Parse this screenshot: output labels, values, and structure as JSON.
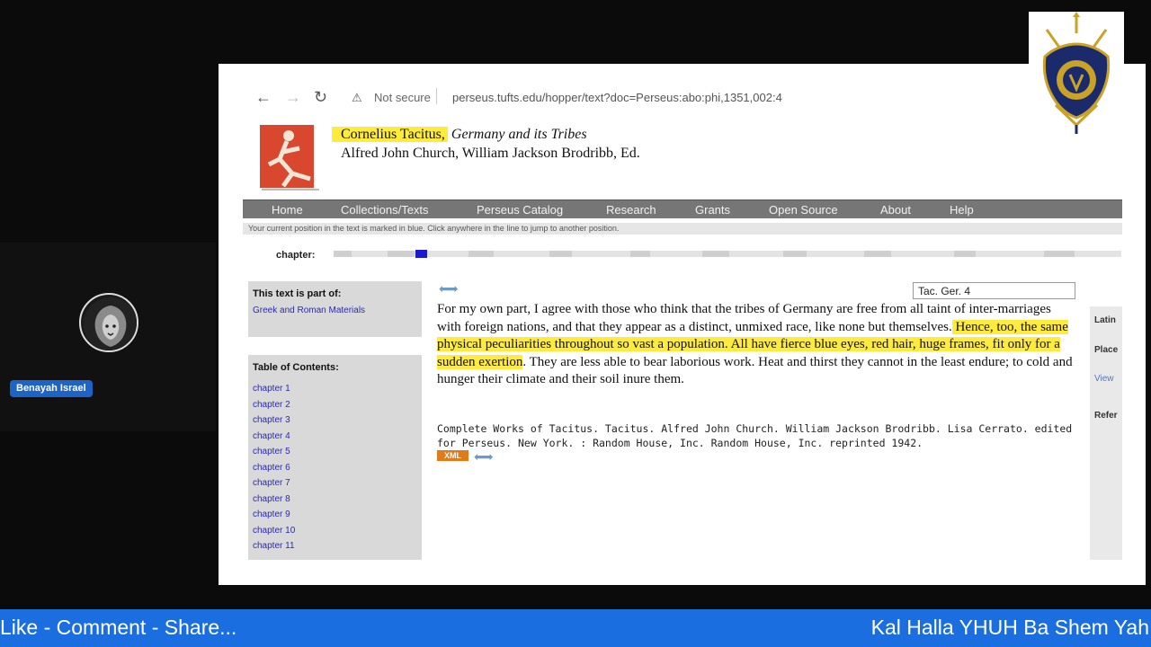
{
  "participant": {
    "name": "Benayah Israel"
  },
  "browser": {
    "security": "Not secure",
    "url": "perseus.tufts.edu/hopper/text?doc=Perseus:abo:phi,1351,002:4"
  },
  "header": {
    "author": "Cornelius Tacitus,",
    "work": "Germany and its Tribes",
    "editors": "Alfred John Church, William Jackson Brodribb, Ed."
  },
  "menu": [
    "Home",
    "Collections/Texts",
    "Perseus Catalog",
    "Research",
    "Grants",
    "Open Source",
    "About",
    "Help"
  ],
  "position_note": "Your current position in the text is marked in blue. Click anywhere in the line to jump to another position.",
  "chapter_label": "chapter:",
  "sidebar": {
    "part_of_title": "This text is part of:",
    "part_of_link": "Greek and Roman Materials",
    "toc_title": "Table of Contents:",
    "chapters": [
      "chapter 1",
      "chapter 2",
      "chapter 3",
      "chapter 4",
      "chapter 5",
      "chapter 6",
      "chapter 7",
      "chapter 8",
      "chapter 9",
      "chapter 10",
      "chapter 11"
    ]
  },
  "reference": "Tac. Ger. 4",
  "text": {
    "before": "For my own part, I agree with those who think that the tribes of Germany are free from all taint of inter-marriages with foreign nations, and that they appear as a distinct, unmixed race, like none but themselves.",
    "highlight": " Hence, too, the same physical peculiarities throughout so vast a population. All have fierce blue eyes, red hair, huge frames, fit only for a sudden exertion",
    "after": ". They are less able to bear laborious work. Heat and thirst they cannot in the least endure; to cold and hunger their climate and their soil inure them."
  },
  "citation": "Complete Works of Tacitus. Tacitus. Alfred John Church. William Jackson Brodribb. Lisa Cerrato. edited for Perseus. New York. : Random House, Inc. Random House, Inc. reprinted 1942.",
  "xml_label": "XML",
  "right_panel": [
    "Latin",
    "Place",
    "View",
    "Refer"
  ],
  "footer": {
    "left": "Like - Comment - Share...",
    "right": "Kal Halla YHUH Ba Shem Yah"
  },
  "colors": {
    "highlight": "#ffeb3b",
    "footer": "#1a6ee0",
    "current_position": "#1a1acc"
  }
}
